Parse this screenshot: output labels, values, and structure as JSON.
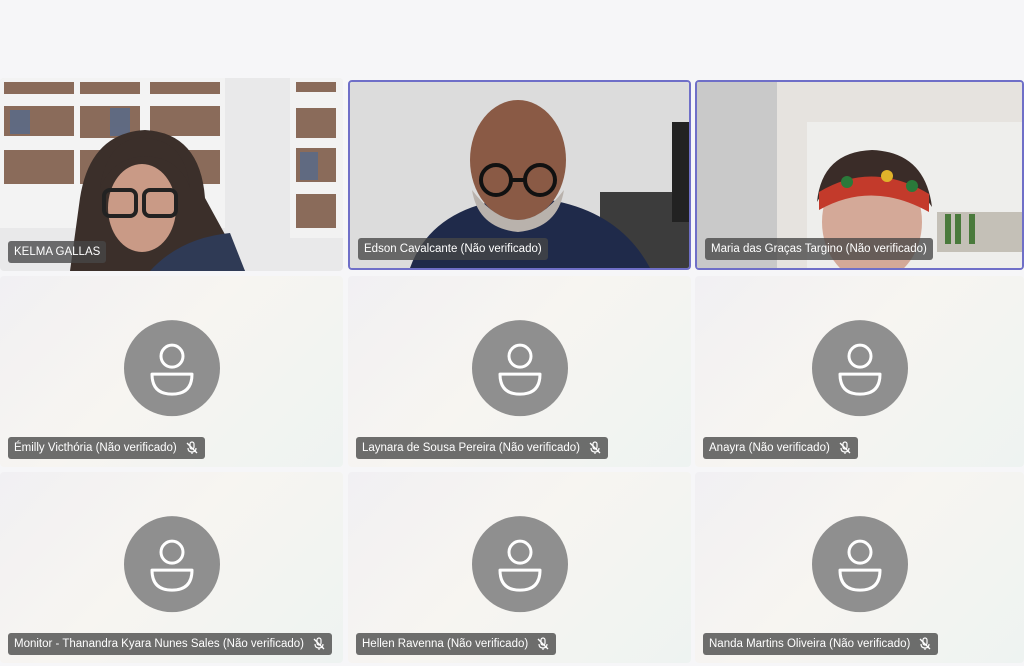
{
  "participants": [
    {
      "name": "KELMA GALLAS",
      "muted": false,
      "video": true
    },
    {
      "name": "Edson Cavalcante (Não verificado)",
      "muted": false,
      "video": true
    },
    {
      "name": "Maria das Graças Targino (Não verificado)",
      "muted": false,
      "video": true
    },
    {
      "name": "Émilly Victhória (Não verificado)",
      "muted": true,
      "video": false
    },
    {
      "name": "Laynara de Sousa Pereira (Não verificado)",
      "muted": true,
      "video": false
    },
    {
      "name": "Anayra (Não verificado)",
      "muted": true,
      "video": false
    },
    {
      "name": "Monitor - Thanandra Kyara Nunes Sales (Não verificado)",
      "muted": true,
      "video": false
    },
    {
      "name": "Hellen Ravenna (Não verificado)",
      "muted": true,
      "video": false
    },
    {
      "name": "Nanda Martins Oliveira (Não verificado)",
      "muted": true,
      "video": false
    }
  ],
  "icons": {
    "avatar": "person-avatar-icon",
    "mic": "mic-off-icon"
  },
  "colors": {
    "active_border": "#6f6fc8",
    "avatar_bg": "#8f8f8f",
    "chip_bg": "#464646"
  }
}
